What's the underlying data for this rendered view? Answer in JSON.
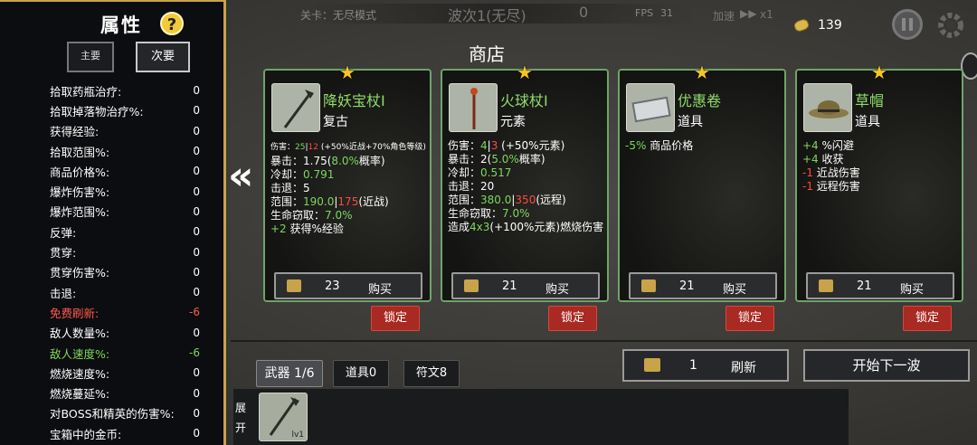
{
  "attributes": {
    "title": "属性",
    "help": "?",
    "tab_main": "主要",
    "tab_sub": "次要",
    "stats": [
      {
        "label": "拾取药瓶治疗:",
        "value": "0",
        "color": "normal"
      },
      {
        "label": "拾取掉落物治疗%:",
        "value": "0",
        "color": "normal"
      },
      {
        "label": "获得经验:",
        "value": "0",
        "color": "normal"
      },
      {
        "label": "拾取范围%:",
        "value": "0",
        "color": "normal"
      },
      {
        "label": "商品价格%:",
        "value": "0",
        "color": "normal"
      },
      {
        "label": "爆炸伤害%:",
        "value": "0",
        "color": "normal"
      },
      {
        "label": "爆炸范围%:",
        "value": "0",
        "color": "normal"
      },
      {
        "label": "反弹:",
        "value": "0",
        "color": "normal"
      },
      {
        "label": "贯穿:",
        "value": "0",
        "color": "normal"
      },
      {
        "label": "贯穿伤害%:",
        "value": "0",
        "color": "normal"
      },
      {
        "label": "击退:",
        "value": "0",
        "color": "normal"
      },
      {
        "label": "免费刷新:",
        "value": "-6",
        "color": "red"
      },
      {
        "label": "敌人数量%:",
        "value": "0",
        "color": "normal"
      },
      {
        "label": "敌人速度%:",
        "value": "-6",
        "color": "green"
      },
      {
        "label": "燃烧速度%:",
        "value": "0",
        "color": "normal"
      },
      {
        "label": "燃烧蔓延%:",
        "value": "0",
        "color": "normal"
      },
      {
        "label": "对BOSS和精英的伤害%:",
        "value": "0",
        "color": "normal"
      },
      {
        "label": "宝箱中的金币:",
        "value": "0",
        "color": "normal"
      }
    ]
  },
  "topbar": {
    "level": "关卡：无尽模式",
    "wave": "波次1(无尽)",
    "wave_count": "0",
    "fps_label": "FPS",
    "fps": "31",
    "speed_label": "加速",
    "speed": "x1"
  },
  "coins": "139",
  "shop": {
    "title": "商店",
    "cards": [
      {
        "name": "降妖宝杖I",
        "type": "复古",
        "lines": [
          [
            {
              "t": "伤害：",
              "c": ""
            },
            {
              "t": "25",
              "c": "g"
            },
            {
              "t": "|",
              "c": ""
            },
            {
              "t": "12",
              "c": "r"
            },
            {
              "t": " (+50%近战+70%角色等级)",
              "c": ""
            }
          ],
          [
            {
              "t": "暴击：1.75(",
              "c": ""
            },
            {
              "t": "8.0%",
              "c": "g"
            },
            {
              "t": "概率)",
              "c": ""
            }
          ],
          [
            {
              "t": "冷却：",
              "c": ""
            },
            {
              "t": "0.791",
              "c": "g"
            }
          ],
          [
            {
              "t": "击退：5",
              "c": ""
            }
          ],
          [
            {
              "t": "范围：",
              "c": ""
            },
            {
              "t": "190.0",
              "c": "g"
            },
            {
              "t": "|",
              "c": ""
            },
            {
              "t": "175",
              "c": "r"
            },
            {
              "t": "(近战)",
              "c": ""
            }
          ],
          [
            {
              "t": "生命窃取：",
              "c": ""
            },
            {
              "t": "7.0%",
              "c": "g"
            }
          ],
          [
            {
              "t": "+2",
              "c": "g"
            },
            {
              "t": " 获得%经验",
              "c": ""
            }
          ]
        ],
        "price": "23",
        "buy": "购买",
        "lock": "锁定"
      },
      {
        "name": "火球杖I",
        "type": "元素",
        "lines": [
          [
            {
              "t": "伤害：",
              "c": ""
            },
            {
              "t": "4",
              "c": "g"
            },
            {
              "t": "|",
              "c": ""
            },
            {
              "t": "3",
              "c": "r"
            },
            {
              "t": " (+50%元素)",
              "c": ""
            }
          ],
          [
            {
              "t": "暴击：2(",
              "c": ""
            },
            {
              "t": "5.0%",
              "c": "g"
            },
            {
              "t": "概率)",
              "c": ""
            }
          ],
          [
            {
              "t": "冷却：",
              "c": ""
            },
            {
              "t": "0.517",
              "c": "g"
            }
          ],
          [
            {
              "t": "击退：20",
              "c": ""
            }
          ],
          [
            {
              "t": "范围：",
              "c": ""
            },
            {
              "t": "380.0",
              "c": "g"
            },
            {
              "t": "|",
              "c": ""
            },
            {
              "t": "350",
              "c": "r"
            },
            {
              "t": "(远程)",
              "c": ""
            }
          ],
          [
            {
              "t": "生命窃取：",
              "c": ""
            },
            {
              "t": "7.0%",
              "c": "g"
            }
          ],
          [
            {
              "t": "造成",
              "c": ""
            },
            {
              "t": "4x3",
              "c": "g"
            },
            {
              "t": "(+100%元素)燃烧伤害",
              "c": ""
            }
          ]
        ],
        "price": "21",
        "buy": "购买",
        "lock": "锁定"
      },
      {
        "name": "优惠卷",
        "type": "道具",
        "lines": [
          [
            {
              "t": "-5%",
              "c": "g"
            },
            {
              "t": " 商品价格",
              "c": ""
            }
          ]
        ],
        "price": "21",
        "buy": "购买",
        "lock": "锁定"
      },
      {
        "name": "草帽",
        "type": "道具",
        "lines": [
          [
            {
              "t": "+4",
              "c": "g"
            },
            {
              "t": " %闪避",
              "c": ""
            }
          ],
          [
            {
              "t": "+4",
              "c": "g"
            },
            {
              "t": " 收获",
              "c": ""
            }
          ],
          [
            {
              "t": "-1",
              "c": "r"
            },
            {
              "t": " 近战伤害",
              "c": ""
            }
          ],
          [
            {
              "t": "-1",
              "c": "r"
            },
            {
              "t": " 远程伤害",
              "c": ""
            }
          ]
        ],
        "price": "21",
        "buy": "购买",
        "lock": "锁定"
      }
    ]
  },
  "bottom": {
    "tab_weapon": "武器 1/6",
    "tab_item": "道具0",
    "tab_rune": "符文8",
    "refresh_price": "1",
    "refresh": "刷新",
    "next_wave": "开始下一波",
    "expand": "展开",
    "slot_level": "lv1"
  }
}
